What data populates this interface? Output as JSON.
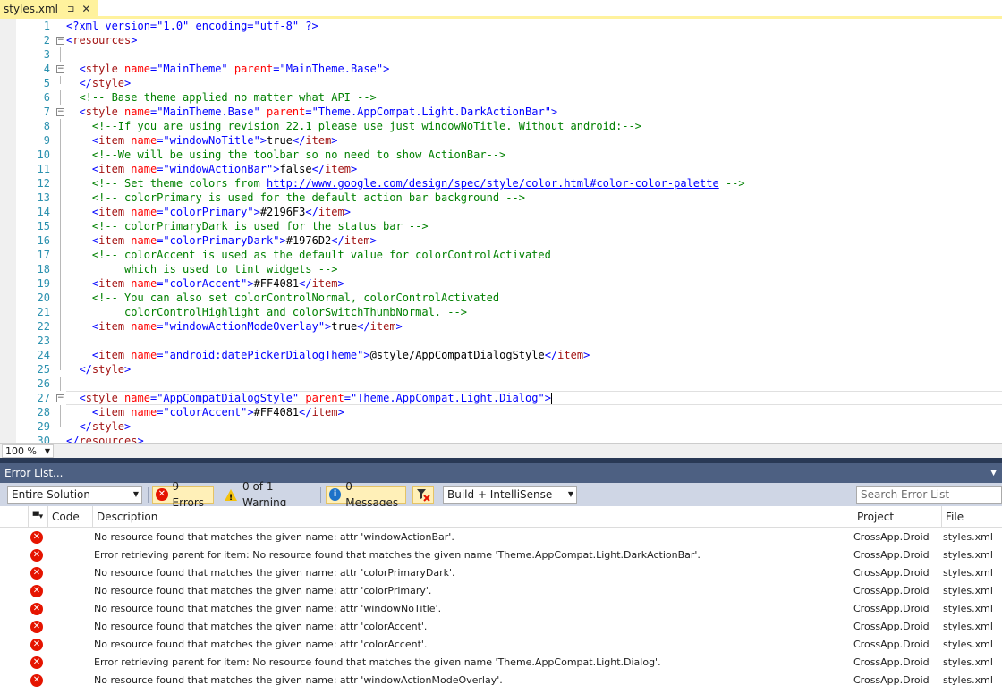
{
  "tab": {
    "title": "styles.xml",
    "pin_glyph": "⊐",
    "close_glyph": "✕"
  },
  "editor": {
    "line_numbers": [
      "1",
      "2",
      "3",
      "4",
      "5",
      "6",
      "7",
      "8",
      "9",
      "10",
      "11",
      "12",
      "13",
      "14",
      "15",
      "16",
      "17",
      "18",
      "19",
      "20",
      "21",
      "22",
      "23",
      "24",
      "25",
      "26",
      "27",
      "28",
      "29",
      "30"
    ],
    "lines": [
      [
        [
          "pi",
          "<?xml version=\"1.0\" encoding=\"utf-8\" ?>"
        ]
      ],
      [
        [
          "punc",
          "<"
        ],
        [
          "tag",
          "resources"
        ],
        [
          "punc",
          ">"
        ]
      ],
      [],
      [
        [
          "txt",
          "  "
        ],
        [
          "punc",
          "<"
        ],
        [
          "tag",
          "style"
        ],
        [
          "txt",
          " "
        ],
        [
          "attr",
          "name"
        ],
        [
          "punc",
          "="
        ],
        [
          "val",
          "\"MainTheme\""
        ],
        [
          "txt",
          " "
        ],
        [
          "attr",
          "parent"
        ],
        [
          "punc",
          "="
        ],
        [
          "val",
          "\"MainTheme.Base\""
        ],
        [
          "punc",
          ">"
        ]
      ],
      [
        [
          "txt",
          "  "
        ],
        [
          "punc",
          "</"
        ],
        [
          "tag",
          "style"
        ],
        [
          "punc",
          ">"
        ]
      ],
      [
        [
          "txt",
          "  "
        ],
        [
          "com",
          "<!-- Base theme applied no matter what API -->"
        ]
      ],
      [
        [
          "txt",
          "  "
        ],
        [
          "punc",
          "<"
        ],
        [
          "tag",
          "style"
        ],
        [
          "txt",
          " "
        ],
        [
          "attr",
          "name"
        ],
        [
          "punc",
          "="
        ],
        [
          "val",
          "\"MainTheme.Base\""
        ],
        [
          "txt",
          " "
        ],
        [
          "attr",
          "parent"
        ],
        [
          "punc",
          "="
        ],
        [
          "val",
          "\"Theme.AppCompat.Light.DarkActionBar\""
        ],
        [
          "punc",
          ">"
        ]
      ],
      [
        [
          "txt",
          "    "
        ],
        [
          "com",
          "<!--If you are using revision 22.1 please use just windowNoTitle. Without android:-->"
        ]
      ],
      [
        [
          "txt",
          "    "
        ],
        [
          "punc",
          "<"
        ],
        [
          "tag",
          "item"
        ],
        [
          "txt",
          " "
        ],
        [
          "attr",
          "name"
        ],
        [
          "punc",
          "="
        ],
        [
          "val",
          "\"windowNoTitle\""
        ],
        [
          "punc",
          ">"
        ],
        [
          "txt",
          "true"
        ],
        [
          "punc",
          "</"
        ],
        [
          "tag",
          "item"
        ],
        [
          "punc",
          ">"
        ]
      ],
      [
        [
          "txt",
          "    "
        ],
        [
          "com",
          "<!--We will be using the toolbar so no need to show ActionBar-->"
        ]
      ],
      [
        [
          "txt",
          "    "
        ],
        [
          "punc",
          "<"
        ],
        [
          "tag",
          "item"
        ],
        [
          "txt",
          " "
        ],
        [
          "attr",
          "name"
        ],
        [
          "punc",
          "="
        ],
        [
          "val",
          "\"windowActionBar\""
        ],
        [
          "punc",
          ">"
        ],
        [
          "txt",
          "false"
        ],
        [
          "punc",
          "</"
        ],
        [
          "tag",
          "item"
        ],
        [
          "punc",
          ">"
        ]
      ],
      [
        [
          "txt",
          "    "
        ],
        [
          "com",
          "<!-- Set theme colors from "
        ],
        [
          "link",
          "http://www.google.com/design/spec/style/color.html#color-color-palette"
        ],
        [
          "com",
          " -->"
        ]
      ],
      [
        [
          "txt",
          "    "
        ],
        [
          "com",
          "<!-- colorPrimary is used for the default action bar background -->"
        ]
      ],
      [
        [
          "txt",
          "    "
        ],
        [
          "punc",
          "<"
        ],
        [
          "tag",
          "item"
        ],
        [
          "txt",
          " "
        ],
        [
          "attr",
          "name"
        ],
        [
          "punc",
          "="
        ],
        [
          "val",
          "\"colorPrimary\""
        ],
        [
          "punc",
          ">"
        ],
        [
          "txt",
          "#2196F3"
        ],
        [
          "punc",
          "</"
        ],
        [
          "tag",
          "item"
        ],
        [
          "punc",
          ">"
        ]
      ],
      [
        [
          "txt",
          "    "
        ],
        [
          "com",
          "<!-- colorPrimaryDark is used for the status bar -->"
        ]
      ],
      [
        [
          "txt",
          "    "
        ],
        [
          "punc",
          "<"
        ],
        [
          "tag",
          "item"
        ],
        [
          "txt",
          " "
        ],
        [
          "attr",
          "name"
        ],
        [
          "punc",
          "="
        ],
        [
          "val",
          "\"colorPrimaryDark\""
        ],
        [
          "punc",
          ">"
        ],
        [
          "txt",
          "#1976D2"
        ],
        [
          "punc",
          "</"
        ],
        [
          "tag",
          "item"
        ],
        [
          "punc",
          ">"
        ]
      ],
      [
        [
          "txt",
          "    "
        ],
        [
          "com",
          "<!-- colorAccent is used as the default value for colorControlActivated"
        ]
      ],
      [
        [
          "com",
          "         which is used to tint widgets -->"
        ]
      ],
      [
        [
          "txt",
          "    "
        ],
        [
          "punc",
          "<"
        ],
        [
          "tag",
          "item"
        ],
        [
          "txt",
          " "
        ],
        [
          "attr",
          "name"
        ],
        [
          "punc",
          "="
        ],
        [
          "val",
          "\"colorAccent\""
        ],
        [
          "punc",
          ">"
        ],
        [
          "txt",
          "#FF4081"
        ],
        [
          "punc",
          "</"
        ],
        [
          "tag",
          "item"
        ],
        [
          "punc",
          ">"
        ]
      ],
      [
        [
          "txt",
          "    "
        ],
        [
          "com",
          "<!-- You can also set colorControlNormal, colorControlActivated"
        ]
      ],
      [
        [
          "com",
          "         colorControlHighlight and colorSwitchThumbNormal. -->"
        ]
      ],
      [
        [
          "txt",
          "    "
        ],
        [
          "punc",
          "<"
        ],
        [
          "tag",
          "item"
        ],
        [
          "txt",
          " "
        ],
        [
          "attr",
          "name"
        ],
        [
          "punc",
          "="
        ],
        [
          "val",
          "\"windowActionModeOverlay\""
        ],
        [
          "punc",
          ">"
        ],
        [
          "txt",
          "true"
        ],
        [
          "punc",
          "</"
        ],
        [
          "tag",
          "item"
        ],
        [
          "punc",
          ">"
        ]
      ],
      [],
      [
        [
          "txt",
          "    "
        ],
        [
          "punc",
          "<"
        ],
        [
          "tag",
          "item"
        ],
        [
          "txt",
          " "
        ],
        [
          "attr",
          "name"
        ],
        [
          "punc",
          "="
        ],
        [
          "val",
          "\"android:datePickerDialogTheme\""
        ],
        [
          "punc",
          ">"
        ],
        [
          "txt",
          "@style/AppCompatDialogStyle"
        ],
        [
          "punc",
          "</"
        ],
        [
          "tag",
          "item"
        ],
        [
          "punc",
          ">"
        ]
      ],
      [
        [
          "txt",
          "  "
        ],
        [
          "punc",
          "</"
        ],
        [
          "tag",
          "style"
        ],
        [
          "punc",
          ">"
        ]
      ],
      [],
      [
        [
          "txt",
          "  "
        ],
        [
          "punc",
          "<"
        ],
        [
          "tag",
          "style"
        ],
        [
          "txt",
          " "
        ],
        [
          "attr",
          "name"
        ],
        [
          "punc",
          "="
        ],
        [
          "val",
          "\"AppCompatDialogStyle\""
        ],
        [
          "txt",
          " "
        ],
        [
          "attr",
          "parent"
        ],
        [
          "punc",
          "="
        ],
        [
          "val",
          "\"Theme.AppCompat.Light.Dialog\""
        ],
        [
          "punc",
          ">"
        ],
        [
          "caret",
          ""
        ]
      ],
      [
        [
          "txt",
          "    "
        ],
        [
          "punc",
          "<"
        ],
        [
          "tag",
          "item"
        ],
        [
          "txt",
          " "
        ],
        [
          "attr",
          "name"
        ],
        [
          "punc",
          "="
        ],
        [
          "val",
          "\"colorAccent\""
        ],
        [
          "punc",
          ">"
        ],
        [
          "txt",
          "#FF4081"
        ],
        [
          "punc",
          "</"
        ],
        [
          "tag",
          "item"
        ],
        [
          "punc",
          ">"
        ]
      ],
      [
        [
          "txt",
          "  "
        ],
        [
          "punc",
          "</"
        ],
        [
          "tag",
          "style"
        ],
        [
          "punc",
          ">"
        ]
      ],
      [
        [
          "punc",
          "</"
        ],
        [
          "tag",
          "resources"
        ],
        [
          "punc",
          ">"
        ]
      ]
    ]
  },
  "zoom": {
    "value": "100 %"
  },
  "error_list": {
    "title": "Error List...",
    "scope": "Entire Solution",
    "errors_label": "9 Errors",
    "warnings_label": "0 of 1 Warning",
    "messages_label": "0 Messages",
    "build_filter": "Build + IntelliSense",
    "search_placeholder": "Search Error List",
    "columns": {
      "code": "Code",
      "description": "Description",
      "project": "Project",
      "file": "File"
    },
    "rows": [
      {
        "description": "No resource found that matches the given name: attr 'windowActionBar'.",
        "project": "CrossApp.Droid",
        "file": "styles.xml"
      },
      {
        "description": "Error retrieving parent for item: No resource found that matches the given name 'Theme.AppCompat.Light.DarkActionBar'.",
        "project": "CrossApp.Droid",
        "file": "styles.xml"
      },
      {
        "description": "No resource found that matches the given name: attr 'colorPrimaryDark'.",
        "project": "CrossApp.Droid",
        "file": "styles.xml"
      },
      {
        "description": "No resource found that matches the given name: attr 'colorPrimary'.",
        "project": "CrossApp.Droid",
        "file": "styles.xml"
      },
      {
        "description": "No resource found that matches the given name: attr 'windowNoTitle'.",
        "project": "CrossApp.Droid",
        "file": "styles.xml"
      },
      {
        "description": "No resource found that matches the given name: attr 'colorAccent'.",
        "project": "CrossApp.Droid",
        "file": "styles.xml"
      },
      {
        "description": "No resource found that matches the given name: attr 'colorAccent'.",
        "project": "CrossApp.Droid",
        "file": "styles.xml"
      },
      {
        "description": "Error retrieving parent for item: No resource found that matches the given name 'Theme.AppCompat.Light.Dialog'.",
        "project": "CrossApp.Droid",
        "file": "styles.xml"
      },
      {
        "description": "No resource found that matches the given name: attr 'windowActionModeOverlay'.",
        "project": "CrossApp.Droid",
        "file": "styles.xml"
      }
    ]
  },
  "colors": {
    "tab_highlight": "#fff29d",
    "tool_window_title": "#4d6082",
    "toolbar_bg": "#cfd6e5",
    "error_red": "#e51400",
    "line_number": "#2b91af",
    "comment_green": "#008000"
  }
}
